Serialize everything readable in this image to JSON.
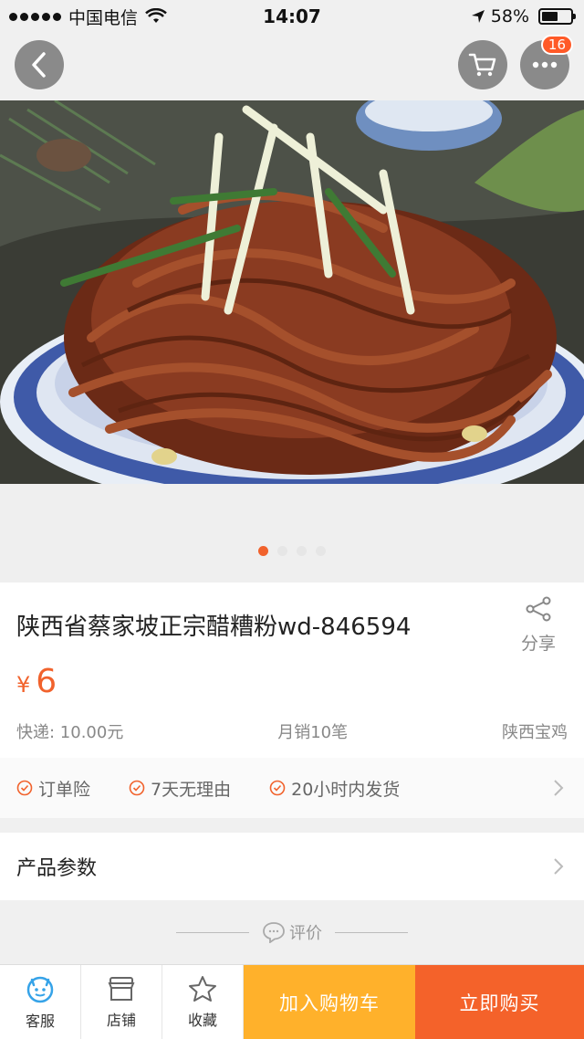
{
  "status_bar": {
    "carrier": "中国电信",
    "time": "14:07",
    "battery": "58%",
    "battery_level": 0.58
  },
  "header": {
    "back_icon": "chevron-left-icon",
    "cart_icon": "cart-icon",
    "more_icon": "more-dots-icon",
    "more_badge": "16"
  },
  "gallery": {
    "image": "noodle-dish-photo",
    "page_count": 4,
    "active_page": 1
  },
  "product": {
    "title": "陕西省蔡家坡正宗醋糟粉wd-846594",
    "share_label": "分享",
    "currency": "¥",
    "price": "6",
    "shipping": "快递: 10.00元",
    "monthly_sales": "月销10笔",
    "location": "陕西宝鸡"
  },
  "guarantees": [
    {
      "label": "订单险"
    },
    {
      "label": "7天无理由"
    },
    {
      "label": "20小时内发货"
    }
  ],
  "params": {
    "label": "产品参数"
  },
  "review": {
    "label": "评价"
  },
  "bottom_bar": {
    "service_label": "客服",
    "store_label": "店铺",
    "favorite_label": "收藏",
    "add_to_cart_label": "加入购物车",
    "buy_now_label": "立即购买"
  },
  "colors": {
    "accent": "#f1622c",
    "cart_button": "#ffb12b",
    "buy_button": "#f4622a"
  }
}
